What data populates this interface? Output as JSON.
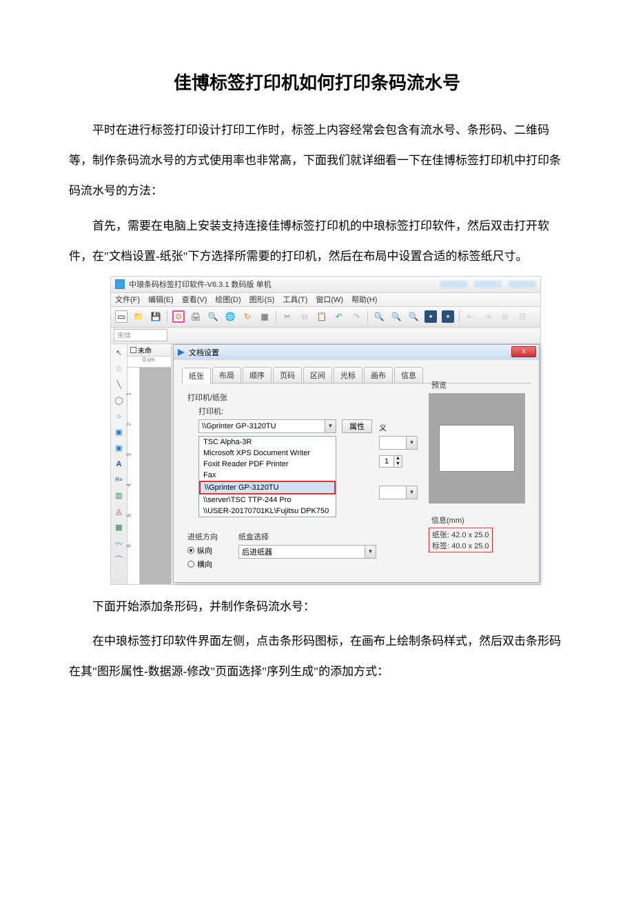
{
  "title": "佳博标签打印机如何打印条码流水号",
  "p1": "平时在进行标签打印设计打印工作时，标签上内容经常会包含有流水号、条形码、二维码等，制作条码流水号的方式使用率也非常高，下面我们就详细看一下在佳博标签打印机中打印条码流水号的方法：",
  "p2": "首先，需要在电脑上安装支持连接佳博标签打印机的中琅标签打印软件，然后双击打开软件，在\"文档设置-纸张\"下方选择所需要的打印机，然后在布局中设置合适的标签纸尺寸。",
  "p3": "下面开始添加条形码，并制作条码流水号：",
  "p4": "在中琅标签打印软件界面左侧，点击条形码图标，在画布上绘制条码样式，然后双击条形码在其\"图形属性-数据源-修改\"页面选择\"序列生成\"的添加方式：",
  "app": {
    "window_title": "中琅条码标签打印软件-V6.3.1 数码版 单机",
    "menu": [
      "文件(F)",
      "编辑(E)",
      "查看(V)",
      "绘图(D)",
      "图形(S)",
      "工具(T)",
      "窗口(W)",
      "帮助(H)"
    ],
    "font_placeholder": "宋体",
    "doc_tab": "未命",
    "ruler_text": "0 cm",
    "v_ticks": [
      "1",
      "2",
      "3",
      "4",
      "5",
      "6"
    ],
    "dialog": {
      "title": "文档设置",
      "close": "x",
      "tabs": [
        "纸张",
        "布局",
        "顺序",
        "页码",
        "区间",
        "光标",
        "画布",
        "信息"
      ],
      "grp_printer": "打印机/纸张",
      "lbl_printer": "打印机:",
      "sel_printer": "\\\\Gprinter GP-3120TU",
      "btn_attr": "属性",
      "lbl_def": "义",
      "options": [
        "TSC Alpha-3R",
        "Microsoft XPS Document Writer",
        "Foxit Reader PDF Printer",
        "Fax",
        "\\\\Gprinter GP-3120TU",
        "\\\\server\\TSC TTP-244 Pro",
        "\\\\USER-20170701KL\\Fujitsu DPK750"
      ],
      "spin_val": "1",
      "feed_lbl": "进纸方向",
      "tray_lbl": "纸盒选择",
      "orient_v": "纵向",
      "orient_h": "横向",
      "tray_opt": "后进纸器",
      "preview_lbl": "预览",
      "info_lbl": "信息(mm)",
      "info_paper": "纸张: 42.0 x 25.0",
      "info_label": "标签: 40.0 x 25.0"
    }
  }
}
